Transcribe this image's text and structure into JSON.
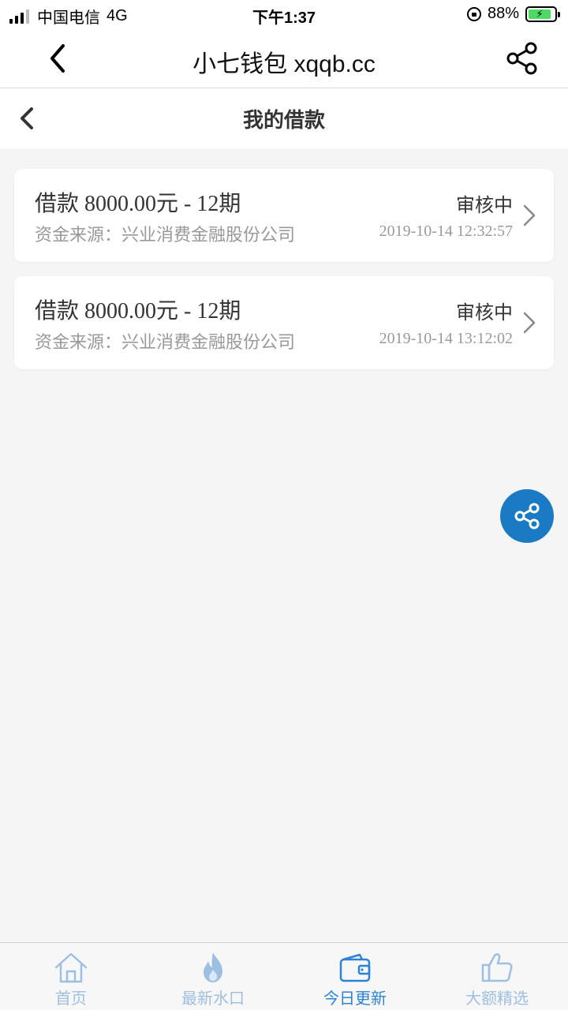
{
  "status_bar": {
    "carrier": "中国电信",
    "network": "4G",
    "time": "下午1:37",
    "battery": "88%",
    "battery_level": 0.88
  },
  "browser_bar": {
    "title": "小七钱包 xqqb.cc",
    "icons": {
      "back": "chevron-left-icon",
      "share": "share-icon"
    }
  },
  "page_header": {
    "title": "我的借款",
    "back_icon": "chevron-left-icon"
  },
  "loans": [
    {
      "title": "借款  8000.00元 - 12期",
      "source": "资金来源：兴业消费金融股份公司",
      "status": "审核中",
      "time": "2019-10-14 12:32:57"
    },
    {
      "title": "借款  8000.00元 - 12期",
      "source": "资金来源：兴业消费金融股份公司",
      "status": "审核中",
      "time": "2019-10-14 13:12:02"
    }
  ],
  "floating_button": {
    "icon": "share-icon",
    "color": "#1a7ac4"
  },
  "tab_bar": {
    "active_color": "#2b82d9",
    "inactive_color": "#9dbfe2",
    "items": [
      {
        "label": "首页",
        "icon": "home-icon",
        "active": false
      },
      {
        "label": "最新水口",
        "icon": "flame-icon",
        "active": false
      },
      {
        "label": "今日更新",
        "icon": "wallet-icon",
        "active": true
      },
      {
        "label": "大额精选",
        "icon": "thumbs-up-icon",
        "active": false
      }
    ]
  }
}
